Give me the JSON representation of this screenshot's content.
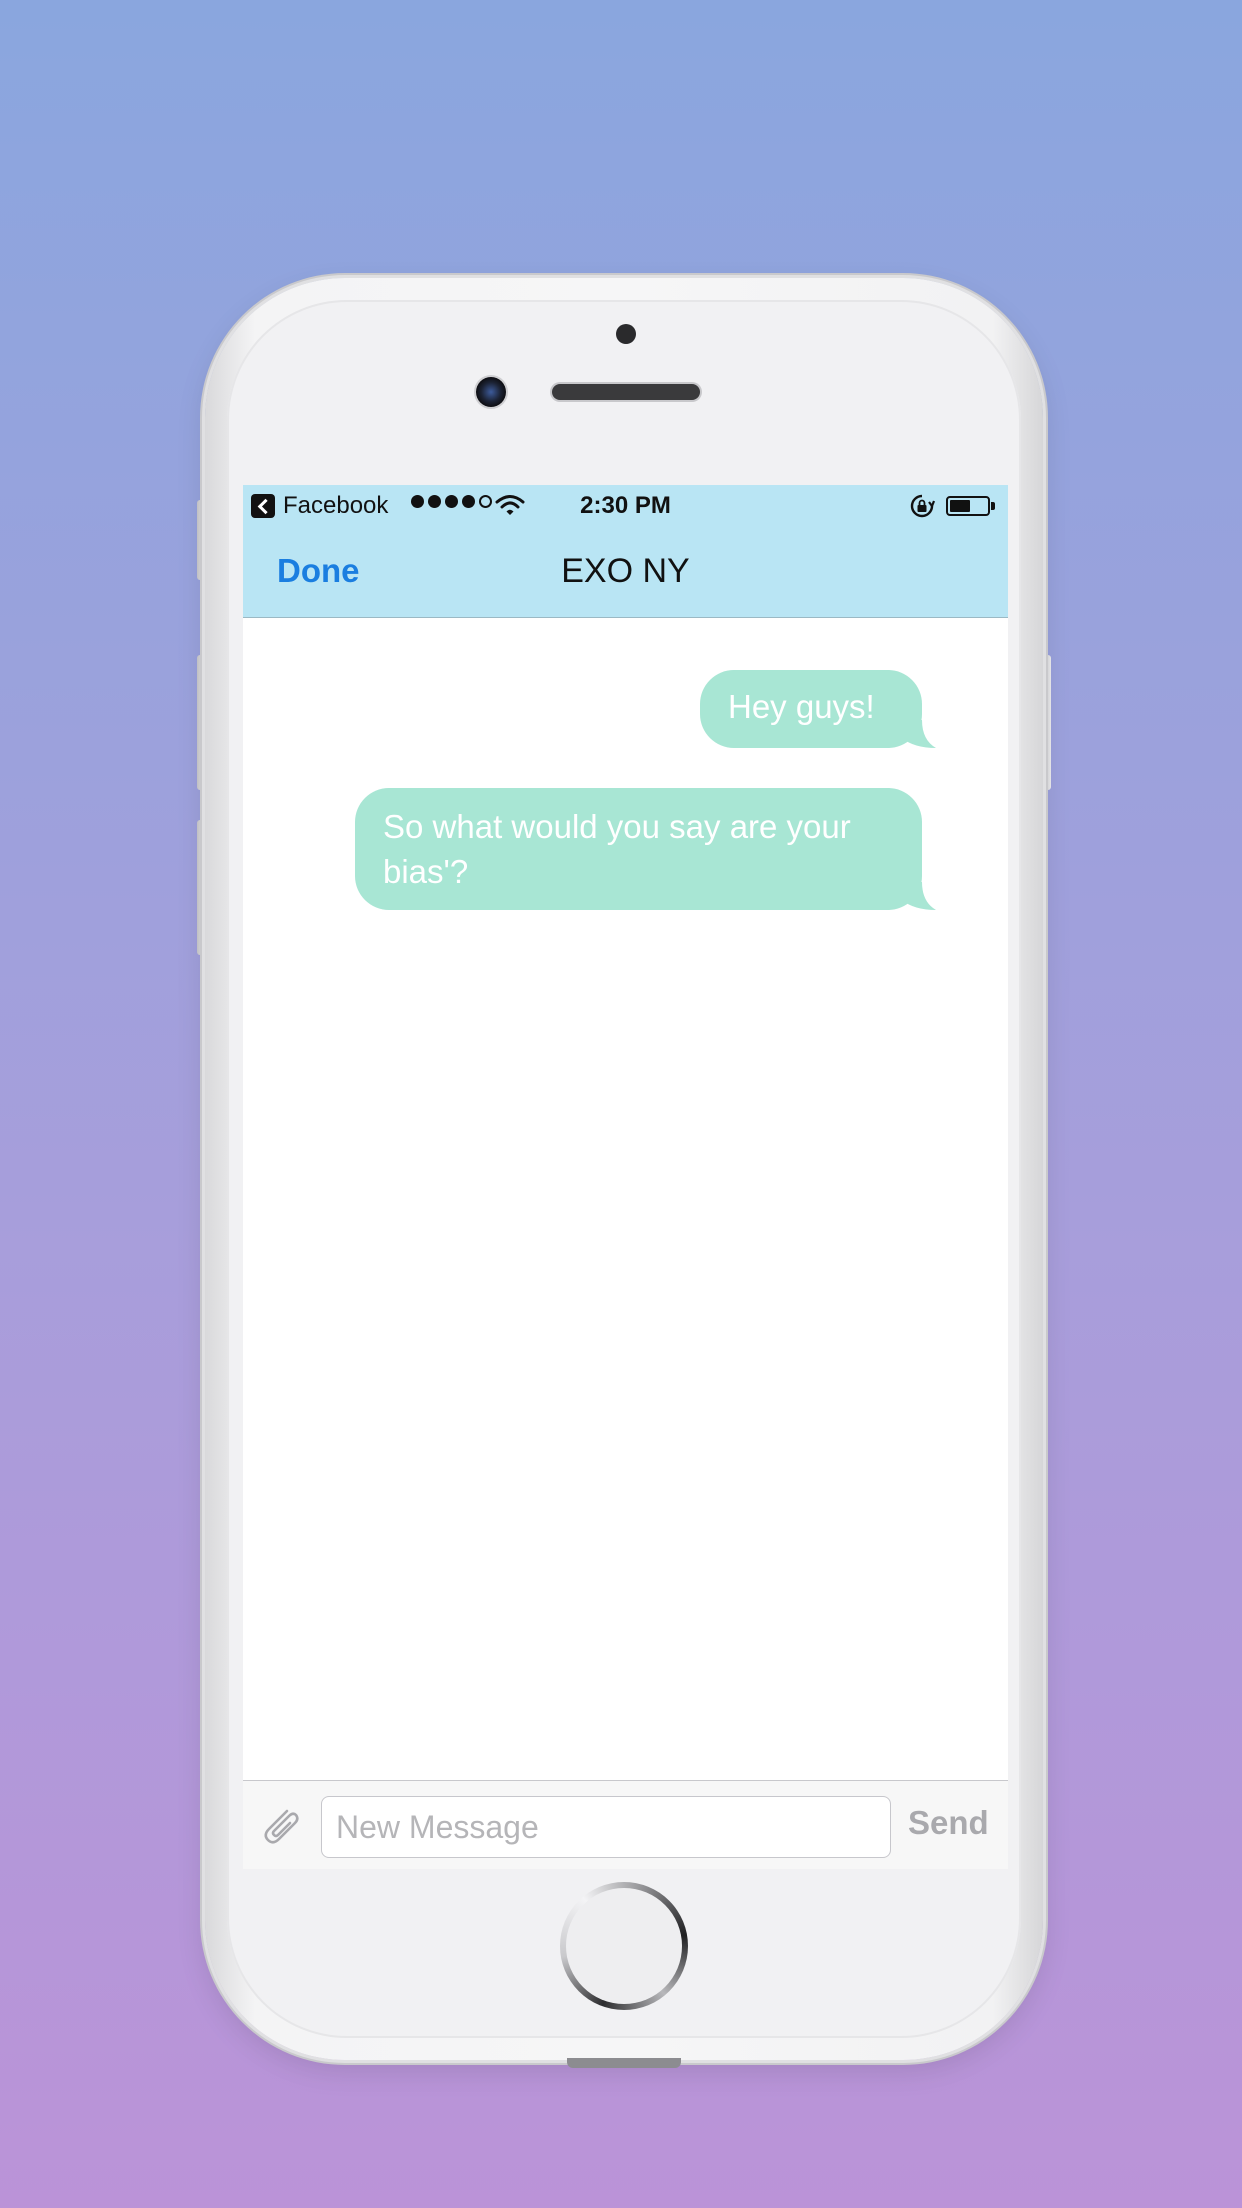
{
  "status_bar": {
    "back_app": "Facebook",
    "time": "2:30 PM",
    "signal_dots_filled": 4,
    "signal_dots_total": 5,
    "battery_level": 0.6
  },
  "nav": {
    "done_label": "Done",
    "title": "EXO NY"
  },
  "messages": [
    {
      "text": "Hey guys!",
      "direction": "outgoing"
    },
    {
      "text": "So what would you say are your bias'?",
      "direction": "outgoing"
    }
  ],
  "composer": {
    "placeholder": "New Message",
    "send_label": "Send"
  },
  "colors": {
    "background_top": "#8aa6de",
    "background_bottom": "#bb93d8",
    "header": "#b9e5f4",
    "bubble": "#a8e6d4",
    "done": "#1a7ee0",
    "send_disabled": "#a9a9ad"
  },
  "icons": {
    "back": "back-arrow-icon",
    "wifi": "wifi-icon",
    "rotation_lock": "rotation-lock-icon",
    "battery": "battery-icon",
    "attach": "paperclip-icon"
  }
}
